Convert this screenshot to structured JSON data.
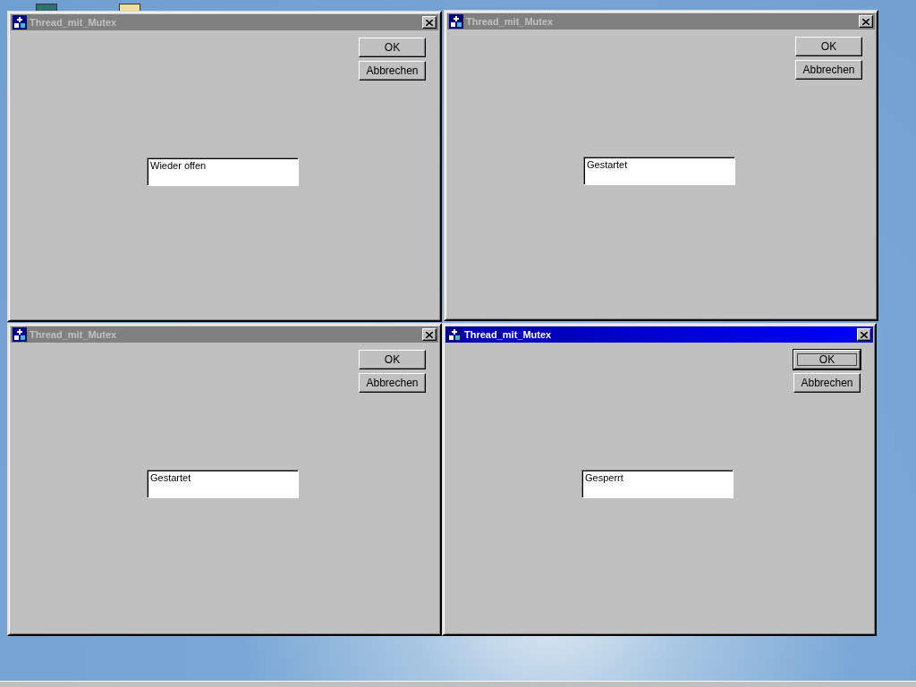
{
  "windows": [
    {
      "title": "Thread_mit_Mutex",
      "active": false,
      "buttons": [
        {
          "label": "OK",
          "focused": false
        },
        {
          "label": "Abbrechen",
          "focused": false
        }
      ],
      "field": {
        "value": "Wieder offen"
      }
    },
    {
      "title": "Thread_mit_Mutex",
      "active": false,
      "buttons": [
        {
          "label": "OK",
          "focused": false
        },
        {
          "label": "Abbrechen",
          "focused": false
        }
      ],
      "field": {
        "value": "Gestartet"
      }
    },
    {
      "title": "Thread_mit_Mutex",
      "active": false,
      "buttons": [
        {
          "label": "OK",
          "focused": false
        },
        {
          "label": "Abbrechen",
          "focused": false
        }
      ],
      "field": {
        "value": "Gestartet"
      }
    },
    {
      "title": "Thread_mit_Mutex",
      "active": true,
      "buttons": [
        {
          "label": "OK",
          "focused": true
        },
        {
          "label": "Abbrechen",
          "focused": false
        }
      ],
      "field": {
        "value": "Gesperrt"
      }
    }
  ]
}
